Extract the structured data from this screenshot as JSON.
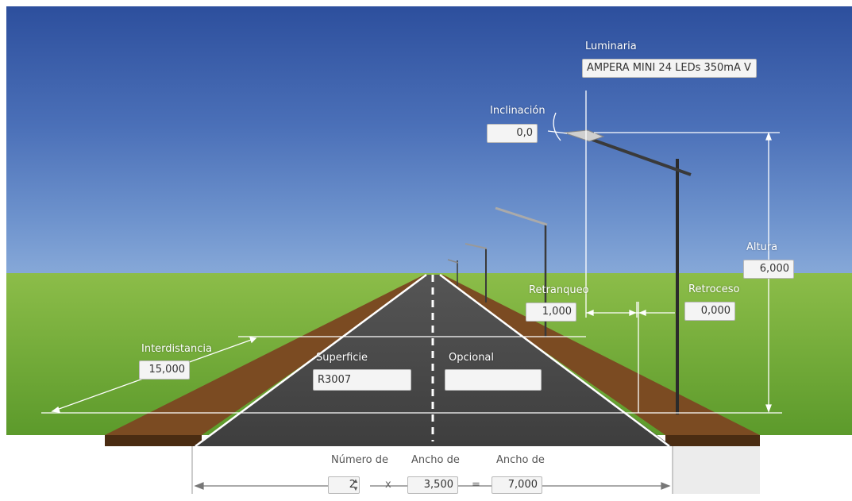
{
  "luminaria": {
    "label": "Luminaria",
    "value": "AMPERA MINI 24 LEDs 350mA V"
  },
  "inclinacion": {
    "label": "Inclinación",
    "value": "0,0"
  },
  "altura": {
    "label": "Altura",
    "value": "6,000"
  },
  "retranqueo": {
    "label": "Retranqueo",
    "value": "1,000"
  },
  "retroceso": {
    "label": "Retroceso",
    "value": "0,000"
  },
  "interdistancia": {
    "label": "Interdistancia",
    "value": "15,000"
  },
  "superficie": {
    "label": "Superficie",
    "value": "R3007"
  },
  "opcional": {
    "label": "Opcional",
    "value": ""
  },
  "bottom": {
    "numero_label": "Número de",
    "numero_value": "2",
    "ancho1_label": "Ancho de",
    "ancho1_value": "3,500",
    "ancho2_label": "Ancho de",
    "ancho2_value": "7,000",
    "times": "x",
    "equals": "="
  },
  "colors": {
    "sky_top": "#2f4f9c",
    "grass": "#6fa035",
    "asphalt": "#4b4b4b",
    "shoulder": "#7a4a22"
  }
}
